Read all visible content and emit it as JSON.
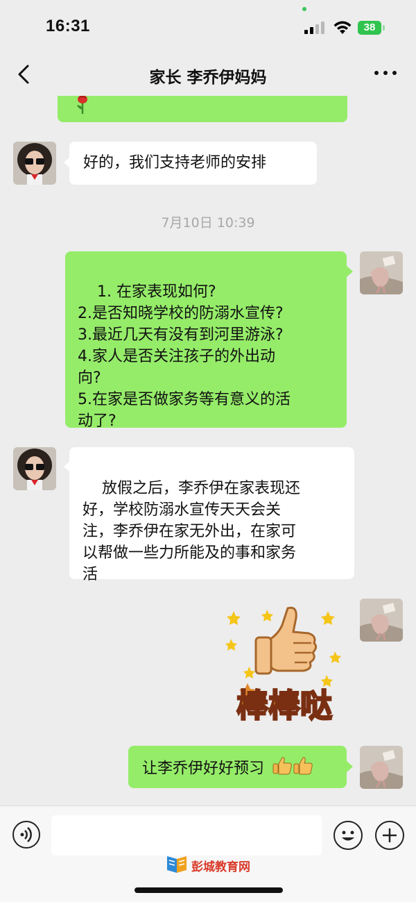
{
  "status": {
    "time": "16:31",
    "battery": "38"
  },
  "header": {
    "title": "家长 李乔伊妈妈"
  },
  "messages": {
    "m1": "好的，我们支持老师的安排",
    "timestamp": "7月10日 10:39",
    "m2": "1. 在家表现如何?\n2.是否知晓学校的防溺水宣传?\n3.最近几天有没有到河里游泳?\n4.家人是否关注孩子的外出动\n向?\n5.在家是否做家务等有意义的活\n动了?",
    "m3": "放假之后，李乔伊在家表现还\n好，学校防溺水宣传天天会关\n注，李乔伊在家无外出，在家可\n以帮做一些力所能及的事和家务\n活",
    "sticker_text": "棒棒哒",
    "m4": "让李乔伊好好预习"
  },
  "watermark": {
    "text": "彭城教育网"
  },
  "colors": {
    "background": "#ededed",
    "sent_bubble": "#95ec69",
    "received_bubble": "#ffffff",
    "timestamp": "#a8a8a8"
  }
}
